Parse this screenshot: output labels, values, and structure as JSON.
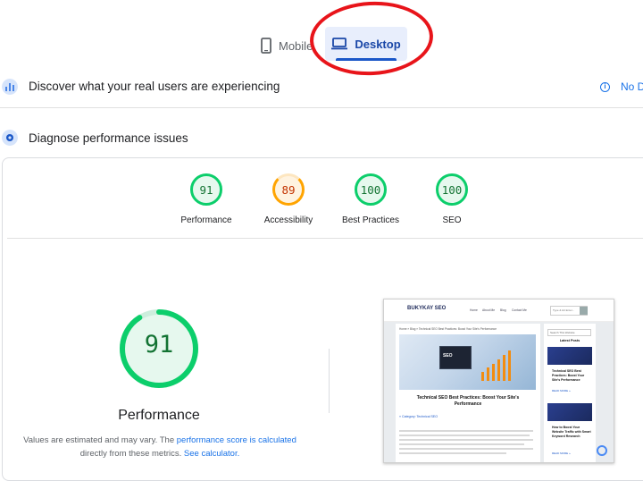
{
  "tabs": {
    "mobile_label": "Mobile",
    "desktop_label": "Desktop"
  },
  "sections": {
    "real_users_title": "Discover what your real users are experiencing",
    "real_users_link": "No D",
    "diagnose_title": "Diagnose performance issues"
  },
  "scores": [
    {
      "label": "Performance",
      "value": "91",
      "status": "good"
    },
    {
      "label": "Accessibility",
      "value": "89",
      "status": "average"
    },
    {
      "label": "Best Practices",
      "value": "100",
      "status": "good"
    },
    {
      "label": "SEO",
      "value": "100",
      "status": "good"
    }
  ],
  "performance": {
    "score": "91",
    "score_fraction": 0.91,
    "title": "Performance",
    "note_prefix": "Values are estimated and may vary. The ",
    "note_link1": "performance score is calculated",
    "note_mid": " directly from these metrics. ",
    "note_link2": "See calculator."
  },
  "thumbnail": {
    "logo": "BUKYKAY SEO",
    "nav": [
      "Home",
      "About Me",
      "Blog",
      "Contact Me"
    ],
    "search_placeholder": "Type & Hit Enter...",
    "breadcrumb": "Home » Blog » Technical SEO Best Practices: Boost Your Site's Performance",
    "hero_text": "SEO",
    "headline": "Technical SEO Best Practices: Boost Your Site's Performance",
    "category": "» Category: Technical SEO",
    "sidebar_search": "Search This Website",
    "latest_posts": "Latest Posts",
    "post1": "Technical SEO Best Practices: Boost Your Site's Performance",
    "post2": "How to Boost Your Website Traffic with Smart Keyword Research",
    "read_more": "READ MORE »"
  },
  "colors": {
    "good": "#0cce6b",
    "average": "#ffa400",
    "link": "#1a73e8",
    "active_tab_bg": "#e8eefc"
  }
}
